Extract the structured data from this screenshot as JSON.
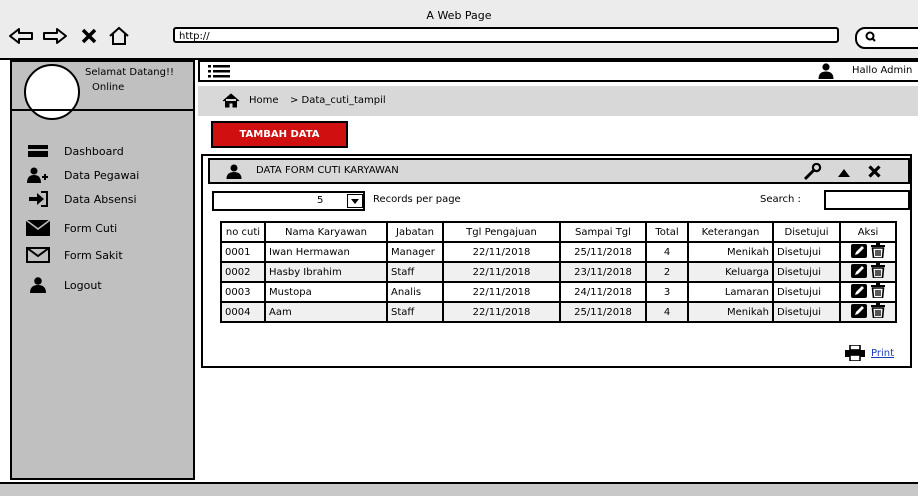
{
  "window": {
    "title": "A Web Page",
    "url": "http://"
  },
  "sidebar": {
    "greeting": "Selamat Datang!!",
    "status": "Online",
    "items": [
      {
        "label": "Dashboard",
        "icon": "keyboard-icon"
      },
      {
        "label": "Data Pegawai",
        "icon": "add-user-icon"
      },
      {
        "label": "Data Absensi",
        "icon": "sign-in-icon"
      },
      {
        "label": "Form Cuti",
        "icon": "envelope-filled-icon"
      },
      {
        "label": "Form Sakit",
        "icon": "envelope-outline-icon"
      },
      {
        "label": "Logout",
        "icon": "user-icon"
      }
    ]
  },
  "topbar": {
    "greeting": "Hallo Admin"
  },
  "breadcrumb": {
    "home": "Home",
    "current": "> Data_cuti_tampil"
  },
  "actions": {
    "add": "TAMBAH DATA"
  },
  "panel": {
    "title": "DATA FORM CUTI KARYAWAN",
    "records_value": "5",
    "records_label": "Records per page",
    "search_label": "Search :",
    "print": "Print"
  },
  "table": {
    "columns": [
      "no cuti",
      "Nama Karyawan",
      "Jabatan",
      "Tgl Pengajuan",
      "Sampai Tgl",
      "Total",
      "Keterangan",
      "Disetujui",
      "Aksi"
    ],
    "rows": [
      [
        "0001",
        "Iwan Hermawan",
        "Manager",
        "22/11/2018",
        "25/11/2018",
        "4",
        "Menikah",
        "Disetujui"
      ],
      [
        "0002",
        "Hasby Ibrahim",
        "Staff",
        "22/11/2018",
        "23/11/2018",
        "2",
        "Keluarga",
        "Disetujui"
      ],
      [
        "0003",
        "Mustopa",
        "Analis",
        "22/11/2018",
        "24/11/2018",
        "3",
        "Lamaran",
        "Disetujui"
      ],
      [
        "0004",
        "Aam",
        "Staff",
        "22/11/2018",
        "25/11/2018",
        "4",
        "Menikah",
        "Disetujui"
      ]
    ]
  },
  "colors": {
    "accent": "#d01010",
    "sidebar": "#c0c0c0",
    "link": "#1a3cc0"
  }
}
